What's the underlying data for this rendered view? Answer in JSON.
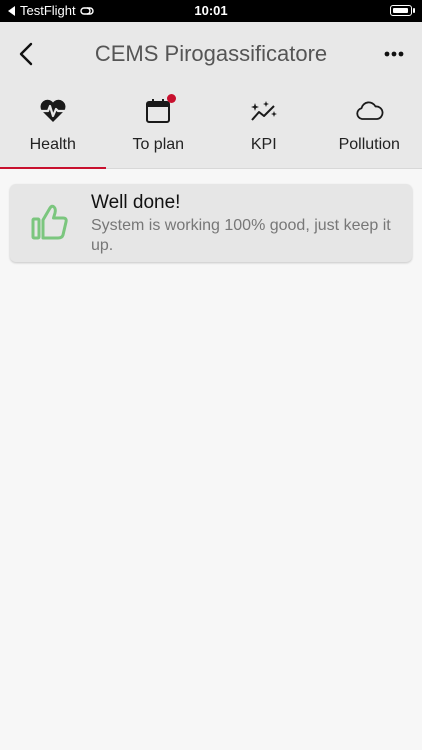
{
  "status_bar": {
    "back_app": "TestFlight",
    "time": "10:01"
  },
  "nav": {
    "title": "CEMS Pirogassificatore",
    "back_icon": "chevron-left-icon",
    "more_icon": "more-horizontal-icon"
  },
  "tabs": [
    {
      "label": "Health",
      "icon": "heart-pulse-icon",
      "active": true
    },
    {
      "label": "To plan",
      "icon": "calendar-icon",
      "badge": true
    },
    {
      "label": "KPI",
      "icon": "sparkle-trend-icon"
    },
    {
      "label": "Pollution",
      "icon": "cloud-icon"
    }
  ],
  "card": {
    "title": "Well done!",
    "message": "System is working 100% good, just keep it up.",
    "icon": "thumbs-up-icon",
    "icon_color": "#7bc67e"
  },
  "colors": {
    "accent": "#c8102e",
    "nav_background": "#e8e8e8",
    "page_background": "#f7f7f7"
  }
}
